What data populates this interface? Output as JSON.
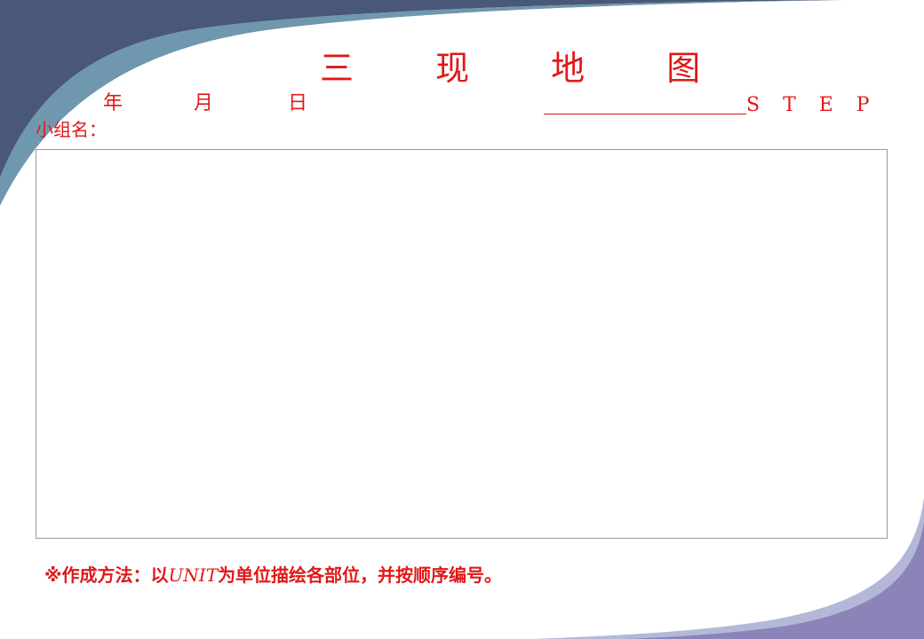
{
  "title": "三 现 地 图",
  "date": {
    "year": "年",
    "month": "月",
    "day": "日"
  },
  "step_label": "STEP",
  "group_label": "小组名：",
  "note": {
    "prefix": "※作成方法：以",
    "unit": "UNIT",
    "suffix": "为单位描绘各部位，并按顺序编号。"
  },
  "colors": {
    "text_red": "#e01818",
    "band_navy": "#4a5878",
    "band_steel": "#6f97ae",
    "band_purple": "#8c84b8",
    "band_lavender": "#b4b8d8",
    "frame_border": "#9a9a9a"
  }
}
